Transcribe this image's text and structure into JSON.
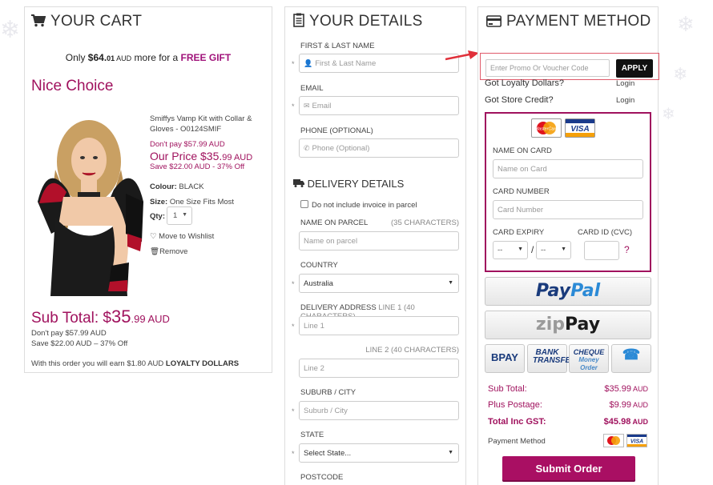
{
  "cart": {
    "title": "YOUR CART",
    "gift_prefix": "Only ",
    "gift_amount": "$64.",
    "gift_cents": "01",
    "gift_currency": " AUD",
    "gift_mid": " more for a ",
    "gift_free": "FREE GIFT",
    "nice_choice": "Nice Choice",
    "product_name": "Smiffys Vamp Kit with Collar & Gloves - O0124SMIF",
    "dont_pay": "Don't pay $57.99 AUD",
    "our_price_label": "Our Price $35.",
    "our_price_cents": "99",
    "our_price_currency": " AUD",
    "save": "Save $22.00 AUD - 37% Off",
    "colour_label": "Colour:",
    "colour_value": " BLACK",
    "size_label": "Size:",
    "size_value": " One Size Fits Most",
    "qty_label": "Qty:",
    "qty_value": "1",
    "wishlist": "Move to Wishlist",
    "remove": "Remove",
    "subtotal_label": "Sub Total: $",
    "subtotal_dollars": "35",
    "subtotal_cents": ".99",
    "subtotal_currency": " AUD",
    "sub_dont_pay": "Don't pay $57.99 AUD",
    "sub_save": "Save $22.00 AUD – 37% Off",
    "loyalty_prefix": "With this order you will earn $1.80 AUD ",
    "loyalty_bold": "LOYALTY DOLLARS"
  },
  "details": {
    "title": "YOUR DETAILS",
    "name_label": "FIRST & LAST NAME",
    "name_placeholder": "First & Last Name",
    "email_label": "EMAIL",
    "email_placeholder": "Email",
    "phone_label": "PHONE (OPTIONAL)",
    "phone_placeholder": "Phone (Optional)",
    "delivery_title": "DELIVERY DETAILS",
    "no_invoice": "Do not include invoice in parcel",
    "parcel_label": "NAME ON PARCEL",
    "parcel_hint": "(35 CHARACTERS)",
    "parcel_placeholder": "Name on parcel",
    "country_label": "COUNTRY",
    "country_value": "Australia",
    "addr_label": "DELIVERY ADDRESS",
    "addr_hint": " LINE 1 (40 CHARACTERS)",
    "line1_placeholder": "Line 1",
    "line2_hint": "LINE 2 (40 CHARACTERS)",
    "line2_placeholder": "Line 2",
    "suburb_label": "SUBURB / CITY",
    "suburb_placeholder": "Suburb / City",
    "state_label": "STATE",
    "state_value": "Select State...",
    "postcode_label": "POSTCODE"
  },
  "payment": {
    "title": "PAYMENT METHOD",
    "promo_placeholder": "Enter Promo Or Voucher Code",
    "apply": "APPLY",
    "loyalty_q": "Got Loyalty Dollars?",
    "credit_q": "Got Store Credit?",
    "login": "Login",
    "mastercard": "MasterCard",
    "visa": "VISA",
    "name_on_card_label": "NAME ON CARD",
    "name_on_card_placeholder": "Name on Card",
    "card_number_label": "CARD NUMBER",
    "card_number_placeholder": "Card Number",
    "expiry_label": "CARD EXPIRY",
    "expiry_month": "--",
    "expiry_year": "--",
    "expiry_sep": "/",
    "cvc_label": "CARD ID (CVC)",
    "cvc_help": "?",
    "paypal_a": "Pay",
    "paypal_b": "Pal",
    "zip_a": "zip",
    "zip_b": "Pay",
    "bpay": "BPAY",
    "bank_transfer": "BANK TRANSFER",
    "cheque": "CHEQUE",
    "money_order": "Money Order",
    "subtotal_label": "Sub Total:",
    "subtotal_value": "$35.99",
    "subtotal_cur": " AUD",
    "postage_label": "Plus Postage:",
    "postage_value": "$9.99",
    "postage_cur": " AUD",
    "total_label": "Total Inc GST:",
    "total_value": "$45.98",
    "total_cur": " AUD",
    "payment_method_label": "Payment Method",
    "submit": "Submit Order"
  },
  "colors": {
    "brand": "#a0125e",
    "submit": "#a90f63",
    "apply_bg": "#111111",
    "paypal_dark": "#1a3b7c",
    "paypal_light": "#2b8ad6"
  },
  "icons": [
    "cart-icon",
    "clipboard-icon",
    "credit-card-icon",
    "truck-icon",
    "user-icon",
    "envelope-icon",
    "phone-icon",
    "heart-icon",
    "trash-icon",
    "telephone-icon"
  ]
}
